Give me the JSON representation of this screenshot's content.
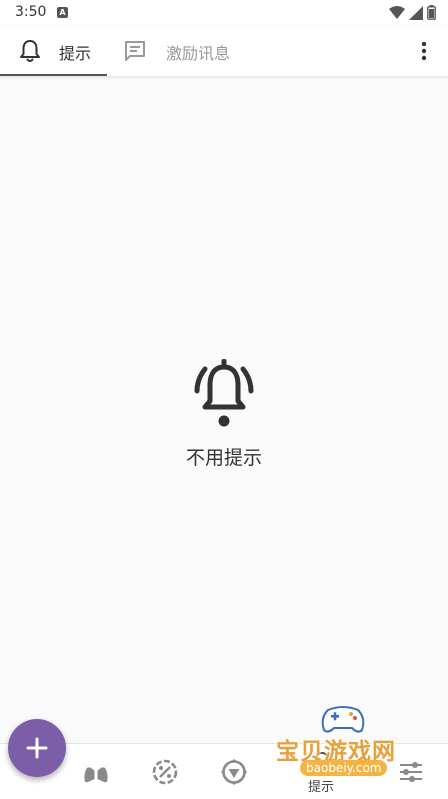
{
  "status_bar": {
    "time": "3:50",
    "notification_glyph": "A"
  },
  "tabs": [
    {
      "label": "提示",
      "icon": "bell-icon",
      "selected": true
    },
    {
      "label": "激励讯息",
      "icon": "message-icon",
      "selected": false
    }
  ],
  "empty_state": {
    "icon": "bell-ringing-icon",
    "text": "不用提示"
  },
  "bottom_nav": {
    "items": [
      {
        "icon": "lungs-icon"
      },
      {
        "icon": "percent-badge-icon"
      },
      {
        "icon": "compass-icon"
      },
      {
        "icon": "bell-icon",
        "label": "提示",
        "selected": true
      },
      {
        "icon": "sliders-icon"
      }
    ]
  },
  "fab": {
    "icon": "plus-icon"
  },
  "watermark": {
    "title": "宝贝游戏网",
    "url": "baobeiy.com"
  },
  "colors": {
    "accent": "#7b5ea7",
    "background": "#fafafa",
    "watermark": "#e8a13a"
  }
}
